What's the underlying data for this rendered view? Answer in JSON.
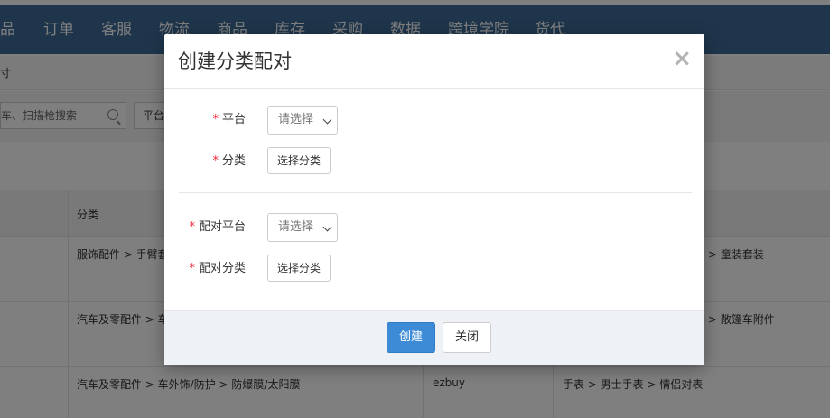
{
  "nav": {
    "items": [
      "品",
      "订单",
      "客服",
      "物流",
      "商品",
      "库存",
      "采购",
      "数据",
      "跨境学院",
      "货代"
    ]
  },
  "breadcrumb": {
    "text": "寸"
  },
  "toolbar": {
    "search_text": "车、扫描枪搜索",
    "platform_filter_label": "平台"
  },
  "table": {
    "headers": {
      "category": "分类"
    },
    "rows": [
      {
        "category": "服饰配件 > 手臂套",
        "platform": "",
        "match": "> 童装套装"
      },
      {
        "category": "汽车及零配件 > 车",
        "platform": "",
        "match": "> 敞篷车附件"
      },
      {
        "category": "汽车及零配件 > 车外饰/防护 > 防爆膜/太阳膜",
        "platform": "ezbuy",
        "match": "手表 > 男士手表 > 情侣对表"
      }
    ]
  },
  "modal": {
    "title": "创建分类配对",
    "close_symbol": "×",
    "required_mark": "*",
    "platform_label": "平台",
    "platform_placeholder": "请选择",
    "category_label": "分类",
    "choose_category": "选择分类",
    "match_platform_label": "配对平台",
    "match_platform_placeholder": "请选择",
    "match_category_label": "配对分类",
    "match_choose_category": "选择分类",
    "create_button": "创建",
    "close_button": "关闭"
  },
  "colors": {
    "nav_bg": "#3d6b96",
    "primary": "#3d8bd6",
    "required": "#e23333",
    "footer_bg": "#eef1f5"
  }
}
